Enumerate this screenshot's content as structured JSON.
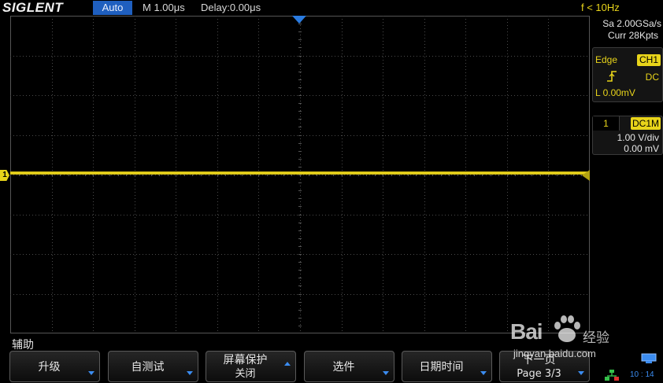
{
  "header": {
    "logo": "SIGLENT",
    "trigger_mode": "Auto",
    "timebase": "M 1.00μs",
    "delay": "Delay:0.00μs",
    "frequency": "f < 10Hz"
  },
  "acquisition": {
    "sample_rate": "Sa 2.00GSa/s",
    "memory_depth": "Curr 28Kpts"
  },
  "trigger": {
    "type": "Edge",
    "source": "CH1",
    "slope_icon": "rising-edge-icon",
    "coupling": "DC",
    "level": "L  0.00mV"
  },
  "channel1": {
    "number": "1",
    "coupling": "DC1M",
    "scale": "1.00 V/div",
    "offset": "0.00 mV",
    "marker": "1"
  },
  "menu": {
    "title": "辅助",
    "softkeys": [
      {
        "line1": "升级",
        "line2": "",
        "arrow": "down"
      },
      {
        "line1": "自测试",
        "line2": "",
        "arrow": "down"
      },
      {
        "line1": "屏幕保护",
        "line2": "关闭",
        "arrow": "up"
      },
      {
        "line1": "选件",
        "line2": "",
        "arrow": "down"
      },
      {
        "line1": "日期时间",
        "line2": "",
        "arrow": "down"
      },
      {
        "line1": "下一页",
        "line2": "Page 3/3",
        "arrow": "down"
      }
    ]
  },
  "status": {
    "clock": "10 : 14",
    "usb_icon": "usb-icon",
    "network_icon": "network-icon"
  },
  "watermark": {
    "brand": "Bai",
    "suffix": "经验",
    "url": "jingyan.baidu.com"
  },
  "colors": {
    "ch1": "#e8d41a",
    "accent_blue": "#1f5fbf",
    "grid": "#4a4a4a",
    "background": "#000000"
  }
}
